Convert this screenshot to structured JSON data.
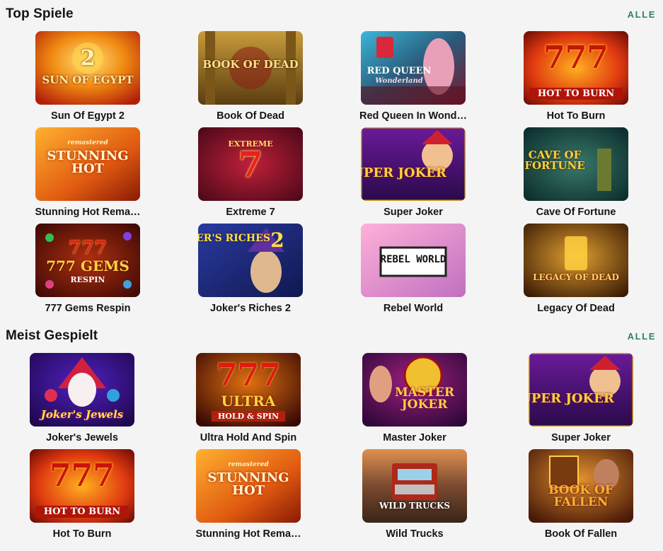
{
  "sections": [
    {
      "title": "Top Spiele",
      "all_label": "ALLE",
      "games": [
        {
          "name": "Sun Of Egypt 2",
          "logo": "SUN OF EGYPT",
          "sub": "2"
        },
        {
          "name": "Book Of Dead",
          "logo": "BOOK OF DEAD",
          "sub": ""
        },
        {
          "name": "Red Queen In Wond…",
          "logo": "RED QUEEN",
          "sub": "Wonderland"
        },
        {
          "name": "Hot To Burn",
          "logo": "HOT TO BURN",
          "sub": "777"
        },
        {
          "name": "Stunning Hot Rema…",
          "logo": "STUNNING HOT",
          "sub": "remastered"
        },
        {
          "name": "Extreme 7",
          "logo": "EXTREME",
          "sub": "7"
        },
        {
          "name": "Super Joker",
          "logo": "SUPER JOKER",
          "sub": ""
        },
        {
          "name": "Cave Of Fortune",
          "logo": "CAVE OF FORTUNE",
          "sub": ""
        },
        {
          "name": "777 Gems Respin",
          "logo": "777 GEMS",
          "sub": "RESPIN"
        },
        {
          "name": "Joker's Riches 2",
          "logo": "JOKER'S RICHES",
          "sub": "2"
        },
        {
          "name": "Rebel World",
          "logo": "REBEL WORLD",
          "sub": ""
        },
        {
          "name": "Legacy Of Dead",
          "logo": "LEGACY OF DEAD",
          "sub": ""
        }
      ]
    },
    {
      "title": "Meist Gespielt",
      "all_label": "ALLE",
      "games": [
        {
          "name": "Joker's Jewels",
          "logo": "Joker's Jewels",
          "sub": ""
        },
        {
          "name": "Ultra Hold And Spin",
          "logo": "ULTRA",
          "sub": "HOLD & SPIN"
        },
        {
          "name": "Master Joker",
          "logo": "MASTER JOKER",
          "sub": ""
        },
        {
          "name": "Super Joker",
          "logo": "SUPER JOKER",
          "sub": ""
        },
        {
          "name": "Hot To Burn",
          "logo": "HOT TO BURN",
          "sub": "777"
        },
        {
          "name": "Stunning Hot Rema…",
          "logo": "STUNNING HOT",
          "sub": "remastered"
        },
        {
          "name": "Wild Trucks",
          "logo": "WILD TRUCKS",
          "sub": ""
        },
        {
          "name": "Book Of Fallen",
          "logo": "BOOK OF FALLEN",
          "sub": ""
        }
      ]
    }
  ],
  "theme": {
    "background": "#f4f4f4",
    "accent": "#2f7f6f",
    "text": "#151515"
  }
}
